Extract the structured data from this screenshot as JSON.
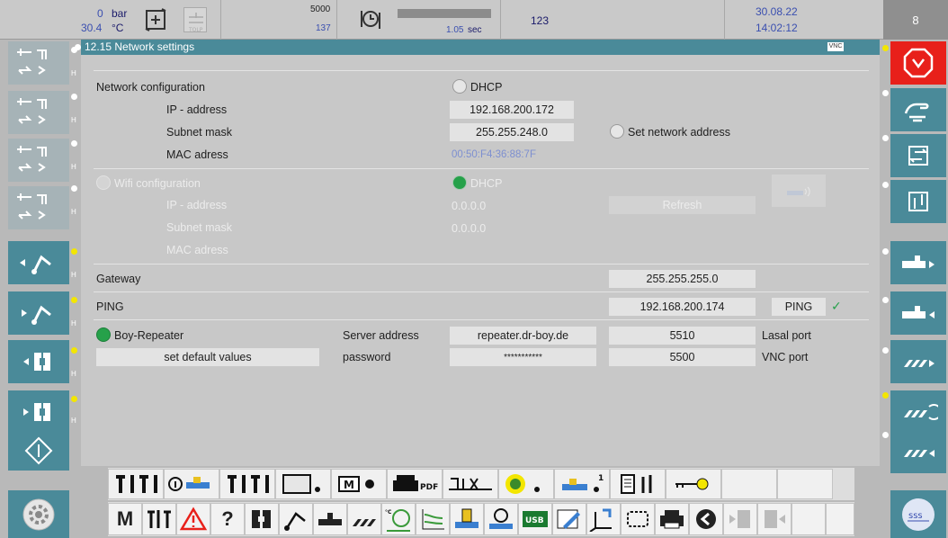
{
  "topbar": {
    "pressure_value": "0",
    "pressure_unit": "bar",
    "temp_value": "30.4",
    "temp_unit": "°C",
    "counter_top": "5000",
    "counter_bottom": "137",
    "cycle_time": "1.05",
    "cycle_unit": "sec",
    "cycle_count": "123",
    "date": "30.08.22",
    "time": "14:02:12",
    "right_number": "8"
  },
  "panel": {
    "title": "12.15 Network settings",
    "vnc_badge": "VNC",
    "network_configuration": "Network configuration",
    "dhcp_label": "DHCP",
    "ip_label": "IP - address",
    "ip_value": "192.168.200.172",
    "subnet_label": "Subnet mask",
    "subnet_value": "255.255.248.0",
    "set_network_address": "Set network address",
    "mac_label": "MAC adress",
    "mac_value": "00:50:F4:36:88:7F",
    "wifi_configuration": "Wifi configuration",
    "wifi_dhcp_label": "DHCP",
    "wifi_ip_label": "IP - address",
    "wifi_ip_value": "0.0.0.0",
    "refresh_label": "Refresh",
    "wifi_subnet_label": "Subnet mask",
    "wifi_subnet_value": "0.0.0.0",
    "wifi_mac_label": "MAC adress",
    "gateway_label": "Gateway",
    "gateway_value": "255.255.255.0",
    "ping_label": "PING",
    "ping_value": "192.168.200.174",
    "ping_button": "PING",
    "ping_ok": "✓",
    "boy_repeater": "Boy-Repeater",
    "server_address_label": "Server address",
    "server_address_value": "repeater.dr-boy.de",
    "lasal_port_value": "5510",
    "lasal_port_label": "Lasal port",
    "set_default_values": "set default values",
    "password_label": "password",
    "password_value": "***********",
    "vnc_port_value": "5500",
    "vnc_port_label": "VNC port"
  },
  "toolbar": {
    "pdf_label": "PDF",
    "usb_label": "USB",
    "m_label": "M",
    "question_label": "?",
    "sss_label": "sss",
    "badge_1": "1"
  },
  "colors": {
    "accent": "#4a8a99",
    "panel_bg": "#c8c8c8",
    "indicator_green": "#26a14a",
    "indicator_yellow": "#f3e600",
    "stop_red": "#e8201a"
  }
}
